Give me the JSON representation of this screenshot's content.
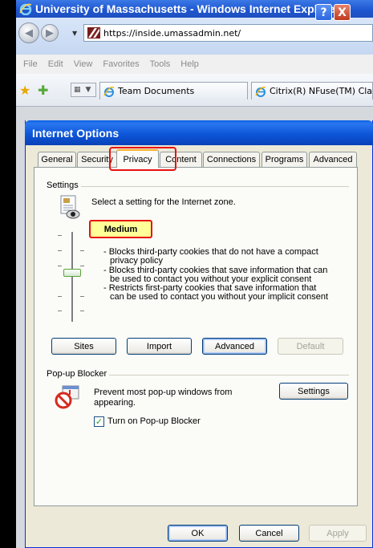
{
  "browser": {
    "title": "University of Massachusetts - Windows Internet Explorer",
    "address": "https://inside.umassadmin.net/",
    "menu": [
      "File",
      "Edit",
      "View",
      "Favorites",
      "Tools",
      "Help"
    ],
    "tabs": [
      "Team Documents",
      "Citrix(R) NFuse(TM) Class"
    ]
  },
  "dialog": {
    "title": "Internet Options",
    "help_label": "?",
    "close_label": "X",
    "tabs": [
      "General",
      "Security",
      "Privacy",
      "Content",
      "Connections",
      "Programs",
      "Advanced"
    ],
    "active_tab": "Privacy",
    "settings": {
      "group_label": "Settings",
      "zone_text": "Select a setting for the Internet zone.",
      "level": "Medium",
      "level_position": 0.5,
      "description": [
        "- Blocks third-party cookies that do not have a compact",
        "privacy policy",
        "- Blocks third-party cookies that save information that can",
        "be used to contact you without your explicit consent",
        "- Restricts first-party cookies that save information that",
        "can be used to contact you without your implicit consent"
      ],
      "buttons": {
        "sites": "Sites",
        "import": "Import",
        "advanced": "Advanced",
        "default": "Default"
      }
    },
    "popup": {
      "group_label": "Pop-up Blocker",
      "text": "Prevent most pop-up windows from appearing.",
      "settings_button": "Settings",
      "checkbox_label": "Turn on Pop-up Blocker",
      "checked": true
    },
    "footer": {
      "ok": "OK",
      "cancel": "Cancel",
      "apply": "Apply"
    }
  },
  "colors": {
    "highlight": "#e8100f",
    "xp_blue": "#0a5fe3",
    "medium_bg": "#ffff99"
  }
}
